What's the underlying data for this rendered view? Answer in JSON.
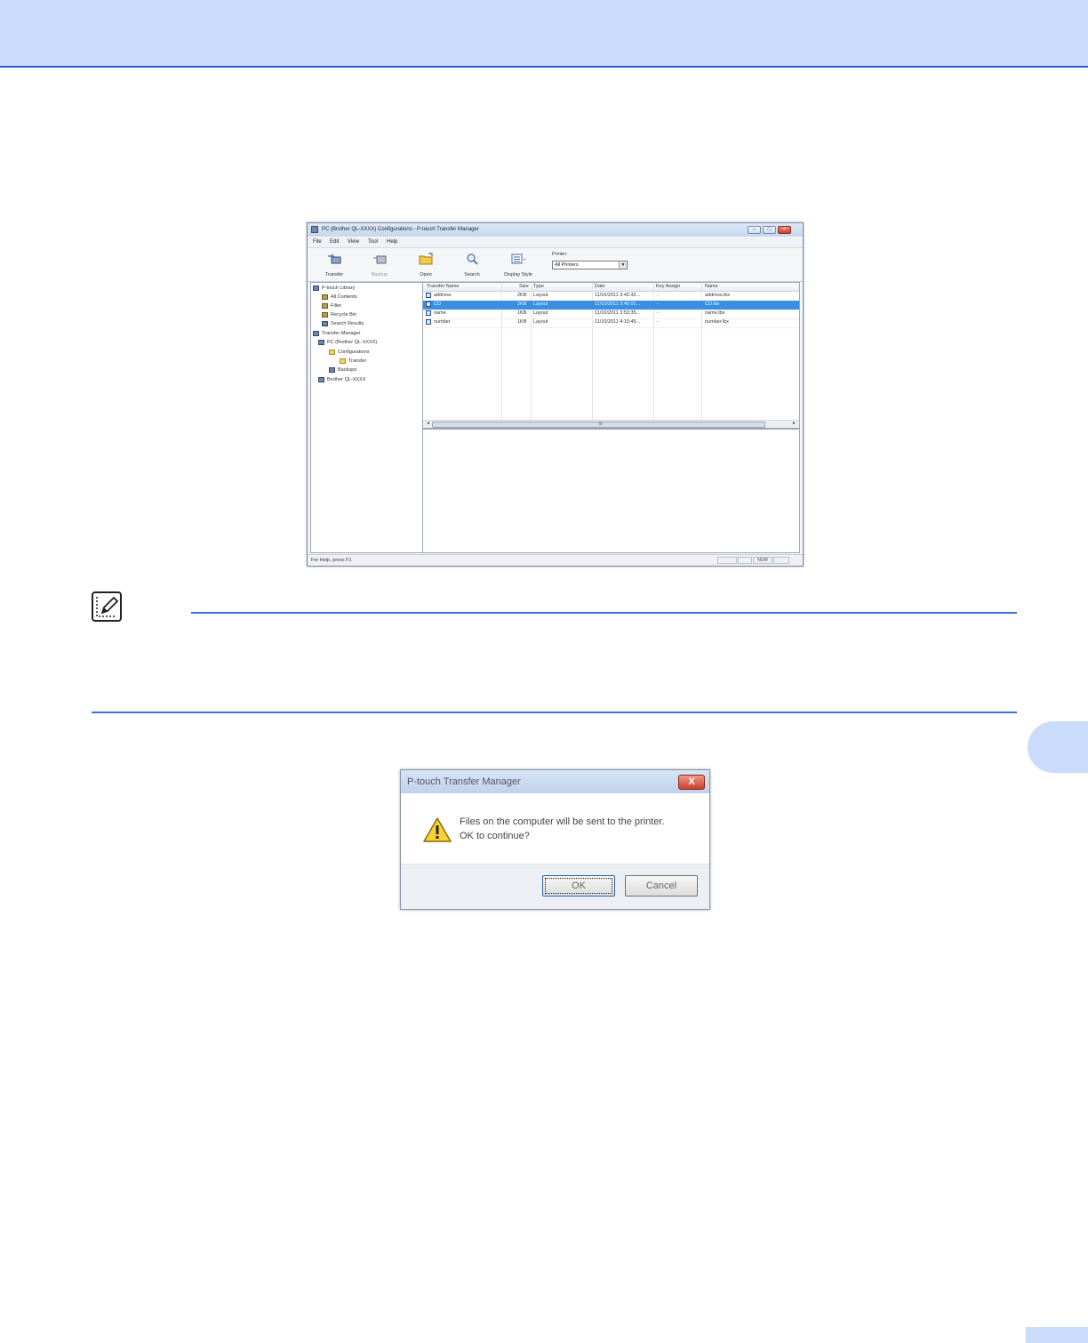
{
  "window": {
    "title": "PC (Brother QL-XXXX) Configurations - P-touch Transfer Manager",
    "menu": [
      "File",
      "Edit",
      "View",
      "Tool",
      "Help"
    ],
    "controls": {
      "minimize": "–",
      "maximize": "□",
      "close": "×"
    },
    "toolbar": {
      "transfer": "Transfer",
      "backup": "Backup",
      "open": "Open",
      "search": "Search",
      "display_style": "Display Style",
      "printer_label": "Printer:",
      "printer_value": "All Printers"
    },
    "tree": [
      "P-touch Library",
      "All Contents",
      "Filter",
      "Recycle Bin",
      "Search Results",
      "Transfer Manager",
      "PC (Brother QL-XXXX)",
      "Configurations",
      "Transfer",
      "Backups",
      "Brother QL-XXXX"
    ],
    "columns": [
      "Transfer Name",
      "Size",
      "Type",
      "Date",
      "Key Assign",
      "Name"
    ],
    "rows": [
      {
        "name": "address",
        "size": "2KB",
        "type": "Layout",
        "date": "11/10/2011 3:42:32...",
        "key": "-",
        "file": "address.lbx",
        "selected": false
      },
      {
        "name": "CD",
        "size": "2KB",
        "type": "Layout",
        "date": "11/10/2011 3:45:01...",
        "key": "-",
        "file": "CD.lbx",
        "selected": true
      },
      {
        "name": "name",
        "size": "1KB",
        "type": "Layout",
        "date": "11/10/2011 3:53:35...",
        "key": "-",
        "file": "name.lbx",
        "selected": false
      },
      {
        "name": "number",
        "size": "1KB",
        "type": "Layout",
        "date": "11/10/2011 4:10:45...",
        "key": "-",
        "file": "number.lbx",
        "selected": false
      }
    ],
    "scroll_center": "III",
    "status": {
      "help": "For Help, press F1",
      "num": "NUM"
    }
  },
  "dialog": {
    "title": "P-touch Transfer Manager",
    "close": "X",
    "message_line1": "Files on the computer will be sent to the printer.",
    "message_line2": "OK to continue?",
    "ok": "OK",
    "cancel": "Cancel"
  }
}
